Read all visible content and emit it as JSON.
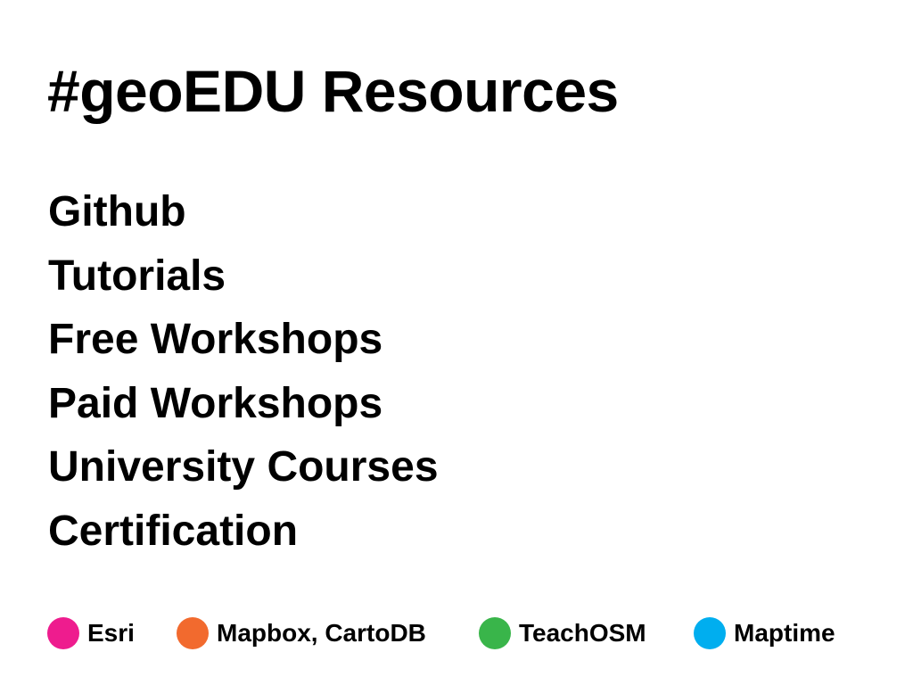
{
  "slide": {
    "title": "#geoEDU Resources",
    "items": [
      "Github",
      "Tutorials",
      "Free Workshops",
      "Paid Workshops",
      "University Courses",
      "Certification"
    ]
  },
  "legend": [
    {
      "label": "Esri",
      "color": "#ee1c8e",
      "icon": "pink-circle-icon"
    },
    {
      "label": "Mapbox, CartoDB",
      "color": "#f26a2e",
      "icon": "orange-circle-icon"
    },
    {
      "label": "TeachOSM",
      "color": "#39b54a",
      "icon": "green-circle-icon"
    },
    {
      "label": "Maptime",
      "color": "#00aeef",
      "icon": "blue-circle-icon"
    }
  ]
}
